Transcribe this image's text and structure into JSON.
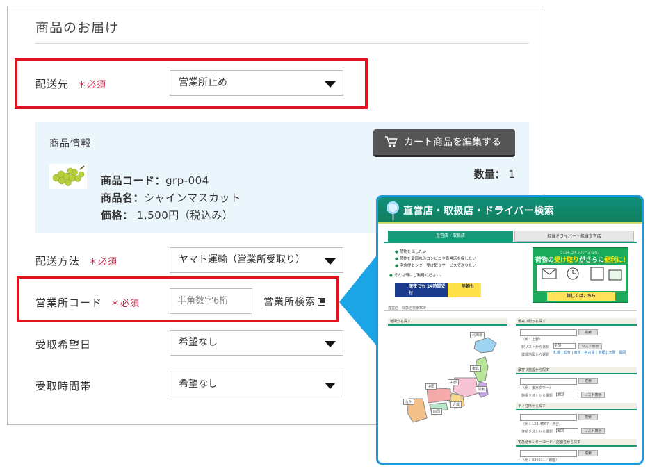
{
  "form": {
    "title": "商品のお届け",
    "required_mark": "＊必須",
    "destination": {
      "label": "配送先",
      "value": "営業所止め"
    },
    "product_panel": {
      "heading": "商品情報",
      "edit_button": "カート商品を編集する",
      "code_label": "商品コード：",
      "code_value": "grp-004",
      "name_label": "商品名：",
      "name_value": "シャインマスカット",
      "price_label": "価格：",
      "price_value": "1,500円（税込み）",
      "qty_label": "数量：",
      "qty_value": "1"
    },
    "shipping_method": {
      "label": "配送方法",
      "value": "ヤマト運輸（営業所受取り）"
    },
    "office_code": {
      "label": "営業所コード",
      "placeholder": "半角数字6桁",
      "search_link": "営業所検索"
    },
    "pickup_date": {
      "label": "受取希望日",
      "value": "希望なし"
    },
    "pickup_time": {
      "label": "受取時間帯",
      "value": "希望なし"
    }
  },
  "popup": {
    "title": "直営店・取扱店・ドライバー検索",
    "tab_active": "直営店・取扱店",
    "tab_other": "担当ドライバー・担当直営店",
    "bullets": [
      "荷物を出したい",
      "荷物を受取れるコンビニや直営店を探したい",
      "宅急便センター受け取りサービスで送りたい"
    ],
    "note": "そんな時にご利用ください。",
    "banner": {
      "line1": "クロネコメンバーズなら、",
      "line2a": "荷物の",
      "line2b": "受け取り",
      "line2c": "がさらに",
      "line2d": "便利に!",
      "bottom": "詳しくはこちら"
    },
    "small_banner_1": "深夜でも 24時間受付",
    "small_banner_2": "早朝も",
    "breadcrumb": "直営店・取扱店検索TOP",
    "map_heading": "地図から探す",
    "regions": [
      "北海道",
      "東北",
      "中部",
      "関東",
      "中国",
      "近畿",
      "四国",
      "九州"
    ],
    "station": {
      "heading": "最寄り駅から探す",
      "example": "（例：上野）",
      "button": "検索",
      "list_label": "駅リストから選択",
      "list_value": "全国",
      "list_button": "リスト表示",
      "detail_label": "詳細地図から選択",
      "areas": "札幌 | 仙台 | 東京 | 名古屋 | 京都 | 大阪 | 福岡"
    },
    "facility": {
      "heading": "最寄り施設から探す",
      "example": "（例：東京タワー）",
      "button": "検索",
      "list_label": "施設リストから選択",
      "list_value": "全国",
      "list_button": "リスト表示"
    },
    "address": {
      "heading": "〒／住所から探す",
      "example": "（例：123-4567／渋谷）",
      "button": "検索",
      "list_label": "住所リストから選択",
      "list_value": "全国",
      "list_button": "リスト表示"
    },
    "center": {
      "heading": "宅急便センターコード／店舗名から探す",
      "example": "（例：036011／銀座）",
      "button": "検索"
    }
  }
}
